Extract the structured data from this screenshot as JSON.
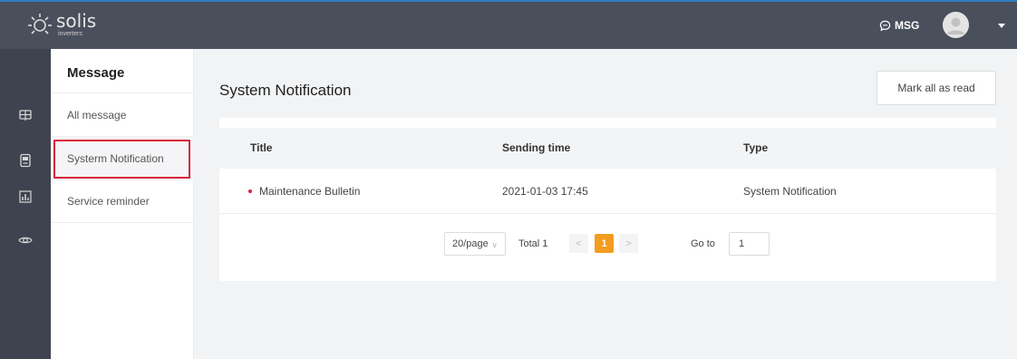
{
  "header": {
    "logo_name": "solis",
    "logo_sub": "inverters",
    "msg_label": "MSG"
  },
  "rail": {
    "icons": [
      "plant-icon",
      "device-icon",
      "report-icon",
      "eye-icon"
    ]
  },
  "submenu": {
    "title": "Message",
    "items": [
      {
        "label": "All message"
      },
      {
        "label": "Systerm Notification"
      },
      {
        "label": "Service reminder"
      }
    ]
  },
  "main": {
    "title": "System Notification",
    "mark_all_label": "Mark all as read",
    "table": {
      "columns": [
        "Title",
        "Sending time",
        "Type"
      ],
      "rows": [
        {
          "title": "Maintenance Bulletin",
          "sending_time": "2021-01-03 17:45",
          "type": "System Notification"
        }
      ]
    },
    "pagination": {
      "page_size": "20/page",
      "total": "Total 1",
      "current_page": "1",
      "prev": "<",
      "next": ">",
      "goto_label": "Go to",
      "goto_value": "1"
    }
  },
  "colors": {
    "topbar": "#4a4f5c",
    "rail": "#3e434f",
    "accent_orange": "#f29d1f",
    "highlight_red": "#d9223a"
  }
}
